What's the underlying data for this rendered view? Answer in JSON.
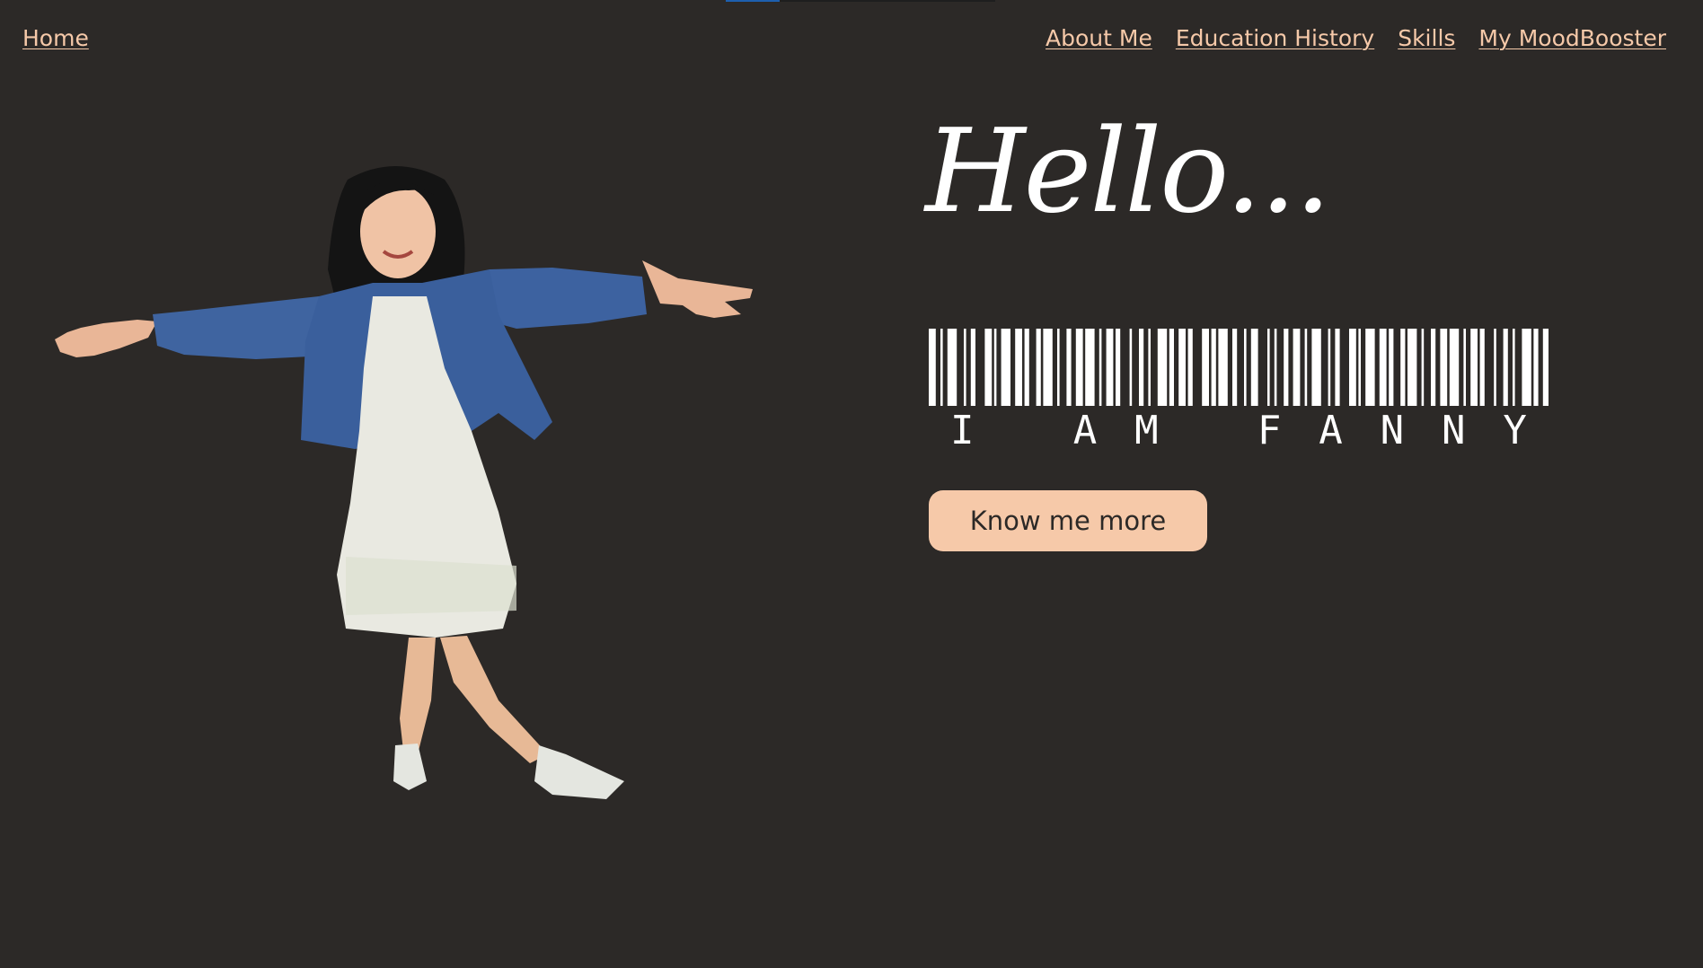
{
  "nav": {
    "home": "Home",
    "links": [
      "About Me",
      "Education History",
      "Skills",
      "My MoodBooster"
    ]
  },
  "hero": {
    "greeting": "Hello...",
    "barcode_text": "I AM FANNY",
    "cta": "Know me more",
    "photo_alt": "Fanny"
  },
  "colors": {
    "background": "#2c2927",
    "accent": "#f6c9a9",
    "text": "#ffffff"
  }
}
